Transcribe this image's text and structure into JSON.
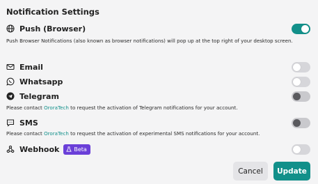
{
  "header": {
    "title": "Notification Settings"
  },
  "channels": {
    "push": {
      "label": "Push (Browser)",
      "icon": "globe-icon",
      "enabled": true,
      "description": "Push Browser Notifications (also known as browser notifications) will pop up at the top right of your desktop screen."
    },
    "email": {
      "label": "Email",
      "icon": "envelope-icon",
      "enabled": false
    },
    "whatsapp": {
      "label": "Whatsapp",
      "icon": "whatsapp-icon",
      "enabled": false
    },
    "telegram": {
      "label": "Telegram",
      "icon": "telegram-icon",
      "enabled": false,
      "disabled": true,
      "note_prefix": "Please contact ",
      "note_link": "OroraTech",
      "note_suffix": " to request the activation of Telegram notifications for your account."
    },
    "sms": {
      "label": "SMS",
      "icon": "sms-icon",
      "enabled": false,
      "disabled": true,
      "note_prefix": "Please contact ",
      "note_link": "OroraTech",
      "note_suffix": " to request the activation of experimental SMS notifications for your account."
    },
    "webhook": {
      "label": "Webhook",
      "icon": "webhook-icon",
      "enabled": false,
      "badge": "Beta",
      "badge_icon": "flask-icon"
    }
  },
  "actions": {
    "cancel_label": "Cancel",
    "update_label": "Update"
  },
  "colors": {
    "accent": "#12908a",
    "badge": "#6a3fd8",
    "toggle_off": "#d6d6da"
  }
}
